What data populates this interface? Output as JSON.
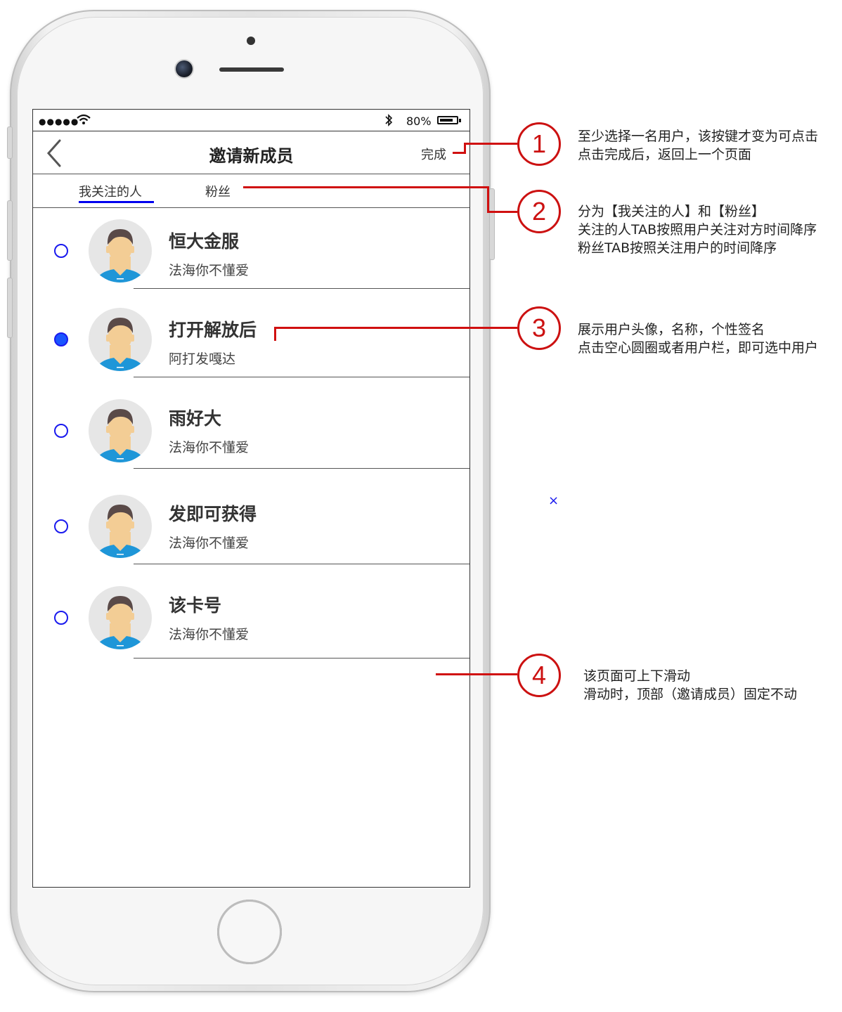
{
  "status_bar": {
    "signal": "●●●●●",
    "bluetooth": "✱",
    "battery_pct": "80%",
    "battery_level": 0.8
  },
  "nav": {
    "back_icon": "chevron-left-icon",
    "title": "邀请新成员",
    "done_label": "完成"
  },
  "tabs": [
    {
      "label": "我关注的人",
      "active": true
    },
    {
      "label": "粉丝",
      "active": false
    }
  ],
  "users": [
    {
      "name": "恒大金服",
      "signature": "法海你不懂爱",
      "selected": false
    },
    {
      "name": "打开解放后",
      "signature": "阿打发嘎达",
      "selected": true
    },
    {
      "name": "雨好大",
      "signature": "法海你不懂爱",
      "selected": false
    },
    {
      "name": "发即可获得",
      "signature": "法海你不懂爱",
      "selected": false
    },
    {
      "name": "该卡号",
      "signature": "法海你不懂爱",
      "selected": false
    }
  ],
  "annotations": [
    {
      "number": "1",
      "lines": [
        "至少选择一名用户，该按键才变为可点击",
        "点击完成后，返回上一个页面"
      ]
    },
    {
      "number": "2",
      "lines": [
        "分为【我关注的人】和【粉丝】",
        "关注的人TAB按照用户关注对方时间降序",
        "粉丝TAB按照关注用户的时间降序"
      ]
    },
    {
      "number": "3",
      "lines": [
        "展示用户头像，名称，个性签名",
        "点击空心圆圈或者用户栏，即可选中用户"
      ]
    },
    {
      "number": "4",
      "lines": [
        "该页面可上下滑动",
        "滑动时，顶部（邀请成员）固定不动"
      ]
    }
  ],
  "stray_mark": "×",
  "colors": {
    "accent_blue": "#1a55ff",
    "tab_underline": "#0000ee",
    "annotation_red": "#cc1111",
    "avatar_shirt": "#1e96d8",
    "avatar_skin": "#f3cd95",
    "avatar_hair": "#5a4a48"
  }
}
